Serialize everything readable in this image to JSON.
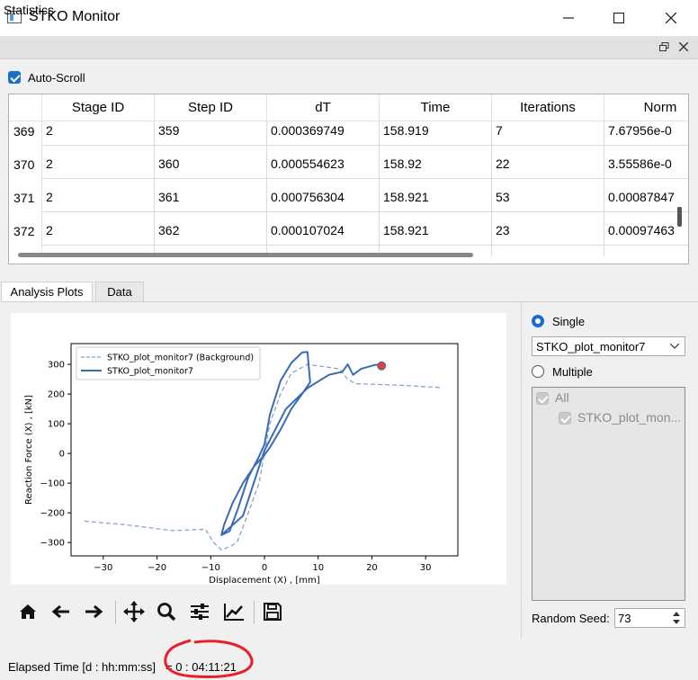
{
  "window": {
    "title": "STKO Monitor"
  },
  "dock": {
    "title": "Statistics"
  },
  "autoscroll": {
    "label": "Auto-Scroll",
    "checked": true
  },
  "table": {
    "headers": [
      "Stage ID",
      "Step ID",
      "dT",
      "Time",
      "Iterations",
      "Norm"
    ],
    "rows": [
      {
        "index": "369",
        "cells": [
          "2",
          "359",
          "0.000369749",
          "158.919",
          "7",
          "7.67956e-0"
        ]
      },
      {
        "index": "370",
        "cells": [
          "2",
          "360",
          "0.000554623",
          "158.92",
          "22",
          "3.55586e-0"
        ]
      },
      {
        "index": "371",
        "cells": [
          "2",
          "361",
          "0.000756304",
          "158.921",
          "53",
          "0.00087847"
        ]
      },
      {
        "index": "372",
        "cells": [
          "2",
          "362",
          "0.000107024",
          "158.921",
          "23",
          "0.00097463"
        ]
      }
    ]
  },
  "tabs": [
    {
      "label": "Analysis Plots",
      "active": true
    },
    {
      "label": "Data",
      "active": false
    }
  ],
  "chart_data": {
    "type": "line",
    "xlabel": "Displacement (X) , [mm]",
    "ylabel": "Reaction Force (X) , [kN]",
    "xlim": [
      -36,
      36
    ],
    "ylim": [
      -345,
      370
    ],
    "xticks": [
      -30,
      -20,
      -10,
      0,
      10,
      20,
      30
    ],
    "yticks": [
      -300,
      -200,
      -100,
      0,
      100,
      200,
      300
    ],
    "xtick_labels": [
      "−30",
      "−20",
      "−10",
      "0",
      "10",
      "20",
      "30"
    ],
    "ytick_labels": [
      "−300",
      "−200",
      "−100",
      "0",
      "100",
      "200",
      "300"
    ],
    "legend_position": "top-left",
    "series": [
      {
        "name": "STKO_plot_monitor7 (Background)",
        "style": "dashed",
        "color": "#7c9fd0",
        "points": [
          [
            -33.5,
            -228
          ],
          [
            -26,
            -240
          ],
          [
            -17,
            -260
          ],
          [
            -11,
            -255
          ],
          [
            -9.5,
            -300
          ],
          [
            -8,
            -325
          ],
          [
            -6,
            -310
          ],
          [
            -5,
            -295
          ],
          [
            -3,
            -200
          ],
          [
            -1,
            -100
          ],
          [
            0,
            0
          ],
          [
            1,
            100
          ],
          [
            3,
            200
          ],
          [
            5,
            270
          ],
          [
            8,
            300
          ],
          [
            12,
            290
          ],
          [
            14,
            285
          ],
          [
            15.5,
            250
          ],
          [
            17,
            235
          ],
          [
            25,
            230
          ],
          [
            33,
            222
          ]
        ]
      },
      {
        "name": "STKO_plot_monitor7",
        "style": "solid",
        "color": "#3a6bb8",
        "points": [
          [
            -8,
            -275
          ],
          [
            -6.5,
            -262
          ],
          [
            -5,
            -190
          ],
          [
            -3,
            -80
          ],
          [
            -1,
            -10
          ],
          [
            0,
            30
          ],
          [
            1,
            130
          ],
          [
            3,
            245
          ],
          [
            5,
            305
          ],
          [
            7,
            340
          ],
          [
            8,
            342
          ],
          [
            8.5,
            240
          ],
          [
            7,
            200
          ],
          [
            5,
            150
          ],
          [
            3,
            80
          ],
          [
            1,
            20
          ],
          [
            0,
            -5
          ],
          [
            -2,
            -45
          ],
          [
            -4,
            -100
          ],
          [
            -6,
            -170
          ],
          [
            -7.5,
            -240
          ],
          [
            -8,
            -275
          ],
          [
            -4,
            -210
          ],
          [
            0,
            10
          ],
          [
            4,
            150
          ],
          [
            8,
            220
          ],
          [
            12,
            265
          ],
          [
            14.5,
            275
          ],
          [
            15.5,
            300
          ],
          [
            16.5,
            265
          ],
          [
            18,
            285
          ],
          [
            20.5,
            298
          ],
          [
            22,
            300
          ]
        ]
      }
    ],
    "marker": {
      "x": 21.8,
      "y": 295,
      "color": "#e0433a"
    }
  },
  "toolbar": {
    "icons": [
      "home-icon",
      "back-arrow-icon",
      "forward-arrow-icon",
      "pan-icon",
      "zoom-icon",
      "configure-subplots-icon",
      "edit-axis-icon",
      "save-icon"
    ]
  },
  "panel": {
    "single_label": "Single",
    "multiple_label": "Multiple",
    "combo_value": "STKO_plot_monitor7",
    "list_items": [
      "All",
      "STKO_plot_mon..."
    ],
    "seed_label": "Random Seed:",
    "seed_value": "73"
  },
  "status": {
    "label": "Elapsed Time [d : hh:mm:ss]",
    "value": "= 0 : 04:11:21",
    "annotation_color": "#e8202a"
  }
}
